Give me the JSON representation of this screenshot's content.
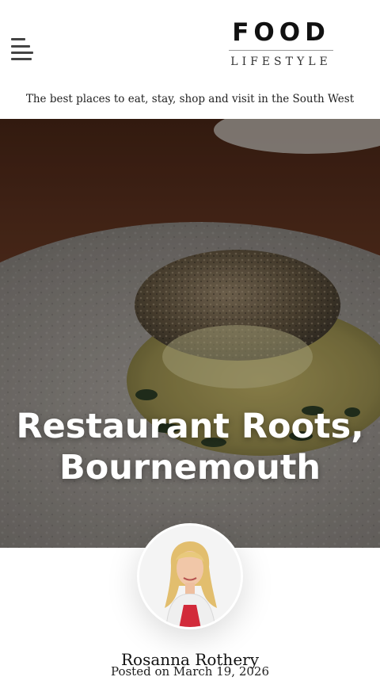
{
  "header": {
    "logo_top": "FOOD",
    "logo_bottom": "LIFESTYLE",
    "tagline": "The best places to eat, stay, shop and visit in the South West"
  },
  "hero": {
    "title_line1": "Restaurant Roots,",
    "title_line2": "Bournemouth"
  },
  "author": {
    "name": "Rosanna Rothery",
    "posted": "Posted on March 19, 2026"
  },
  "icons": {
    "menu": "hamburger-menu-icon"
  }
}
